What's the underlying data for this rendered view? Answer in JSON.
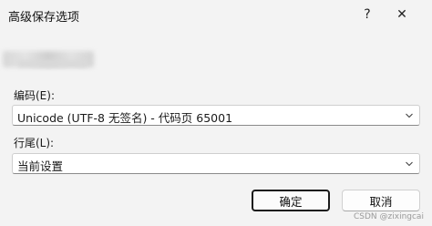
{
  "window": {
    "title": "高级保存选项",
    "help_glyph": "?",
    "close_glyph": "✕"
  },
  "encoding": {
    "label": "编码(E):",
    "selected": "Unicode (UTF-8 无签名) - 代码页 65001"
  },
  "line_endings": {
    "label": "行尾(L):",
    "selected": "当前设置"
  },
  "buttons": {
    "ok": "确定",
    "cancel": "取消"
  },
  "watermark": "CSDN @zixingcai",
  "icons": [
    "help-icon",
    "close-icon",
    "chevron-down-icon"
  ]
}
